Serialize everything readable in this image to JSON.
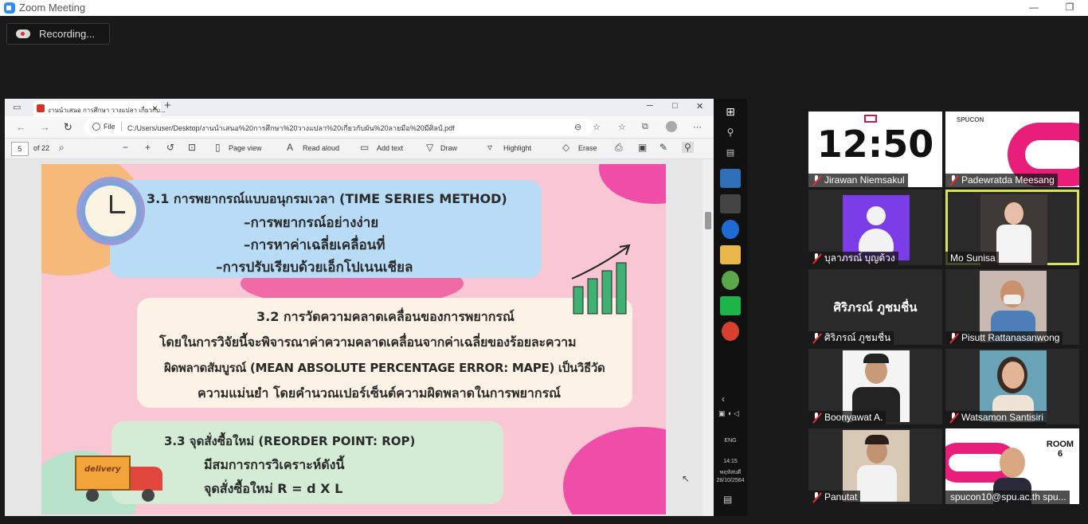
{
  "window": {
    "title": "Zoom Meeting",
    "minimize_glyph": "—",
    "restore_glyph": "❐"
  },
  "recording": {
    "label": "Recording...",
    "icon": "cloud-record-icon"
  },
  "browser": {
    "tab_title": "งานนำเสนอ การศึกษา วางแปลา เกี่ยวกับ...",
    "new_tab": "+",
    "url_label": "File",
    "url": "C:/Users/user/Desktop/งานนำเสนอ%20การศึกษา%20วางแปลา%20เกี่ยวกับผัน%20ลายมือ%20มีศิลป์.pdf",
    "page_current": "5",
    "page_total": "of 22",
    "toolbar": {
      "page_view": "Page view",
      "read_aloud": "Read aloud",
      "add_text": "Add text",
      "draw": "Draw",
      "highlight": "Highlight",
      "erase": "Erase"
    }
  },
  "slide": {
    "s1_title": "3.1 การพยากรณ์แบบอนุกรมเวลา (TIME SERIES METHOD)",
    "s1_items": [
      "–การพยากรณ์อย่างง่าย",
      "–การหาค่าเฉลี่ยเคลื่อนที่",
      "–การปรับเรียบด้วยเอ็กโปเนนเชียล"
    ],
    "s2_title": "3.2 การวัดความคลาดเคลื่อนของการพยากรณ์",
    "s2_lines": [
      "โดยในการวิจัยนี้จะพิจารณาค่าความคลาดเคลื่อนจากค่าเฉลี่ยของร้อยละความ",
      "ผิดพลาดสัมบูรณ์ (MEAN ABSOLUTE PERCENTAGE ERROR: MAPE) เป็นวิธีวัด",
      "ความแม่นยำ โดยคำนวณเปอร์เซ็นต์ความผิดพลาดในการพยากรณ์"
    ],
    "s3_title": "3.3 จุดสั่งซื้อใหม่ (REORDER POINT: ROP)",
    "s3_lines": [
      "มีสมการการวิเคราะห์ดังนี้",
      "จุดสั่งซื้อใหม่  R = d X L"
    ],
    "truck_label": "delivery"
  },
  "taskbar": {
    "lang": "ENG",
    "time": "14:15",
    "day": "พฤหัสบดี",
    "date": "28/10/2564"
  },
  "participants": [
    {
      "name": "Jirawan Niemsakul",
      "display": "12:50"
    },
    {
      "name": "Padewratda Meesang",
      "display": "SPUCON"
    },
    {
      "name": "บุลาภรณ์ บุญต้วง",
      "display": ""
    },
    {
      "name": "Mo Sunisa",
      "display": ""
    },
    {
      "name": "ศิริภรณ์ ภูชมชื่น",
      "display": "ศิริภรณ์ ภูชมชื่น"
    },
    {
      "name": "Pisutt Rattanasanwong",
      "display": ""
    },
    {
      "name": "Boonyawat A.",
      "display": ""
    },
    {
      "name": "Watsamon Santisiri",
      "display": ""
    },
    {
      "name": "Panutat",
      "display": ""
    },
    {
      "name": "spucon10@spu.ac.th spu...",
      "display": "ROOM 6"
    }
  ],
  "colors": {
    "accent_active": "#d7e35a",
    "muted_red": "#e8302c",
    "zoom_blue": "#2d8cff",
    "slide_bg": "#f9c7d3"
  }
}
